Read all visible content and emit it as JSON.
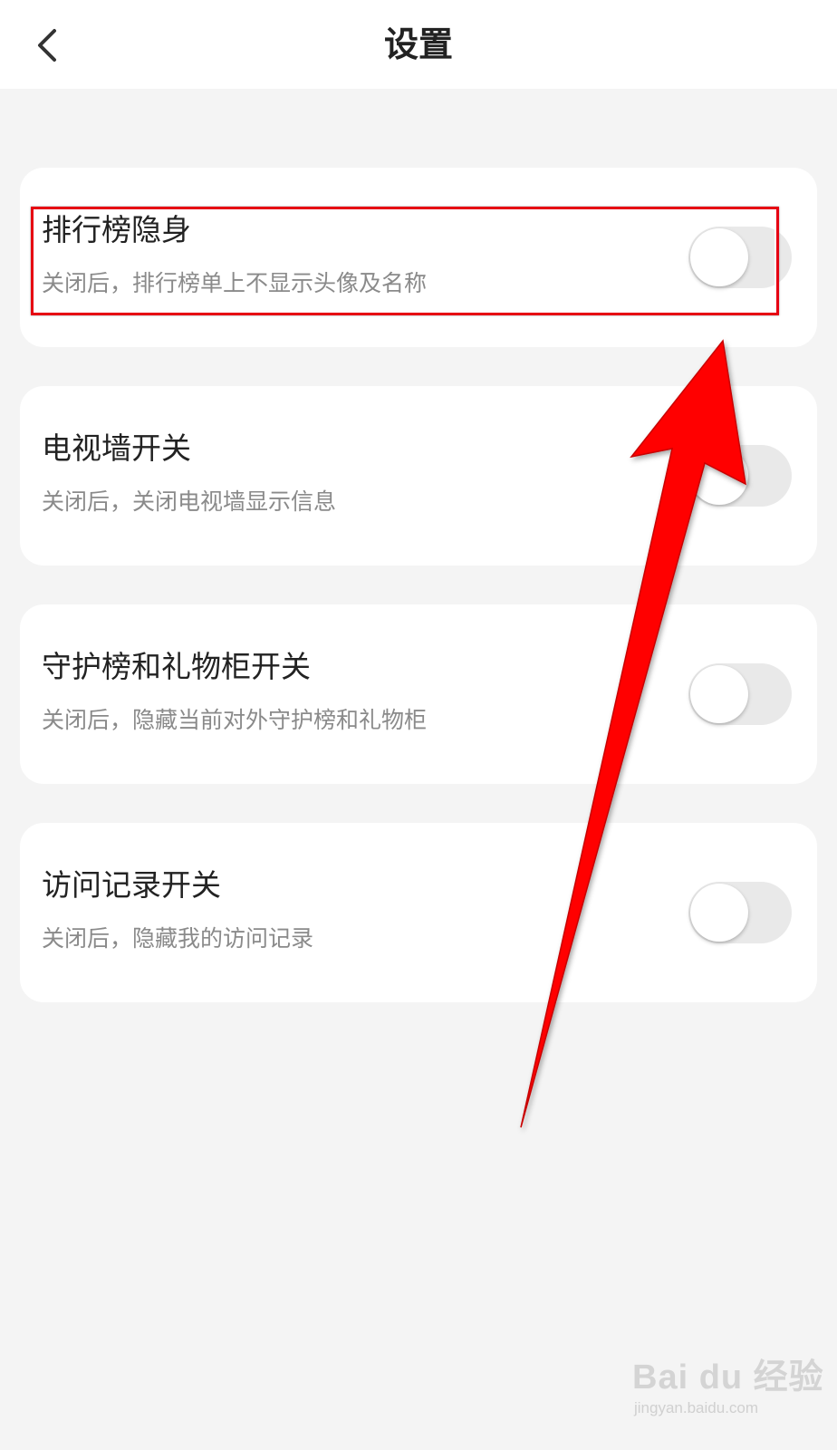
{
  "header": {
    "title": "设置",
    "back_icon": "chevron-left-icon"
  },
  "settings": [
    {
      "title": "排行榜隐身",
      "desc": "关闭后，排行榜单上不显示头像及名称",
      "enabled": false
    },
    {
      "title": "电视墙开关",
      "desc": "关闭后，关闭电视墙显示信息",
      "enabled": false
    },
    {
      "title": "守护榜和礼物柜开关",
      "desc": "关闭后，隐藏当前对外守护榜和礼物柜",
      "enabled": false
    },
    {
      "title": "访问记录开关",
      "desc": "关闭后，隐藏我的访问记录",
      "enabled": false
    }
  ],
  "annotation": {
    "highlight_color": "#e60012",
    "arrow_color": "#ff0000",
    "arrow_icon": "red-arrow-icon"
  },
  "watermark": {
    "brand": "Bai du 经验",
    "url": "jingyan.baidu.com"
  },
  "colors": {
    "background": "#f4f4f4",
    "card": "#ffffff",
    "toggle_off": "#e9e9e9",
    "desc_text": "#8a8a8a"
  }
}
